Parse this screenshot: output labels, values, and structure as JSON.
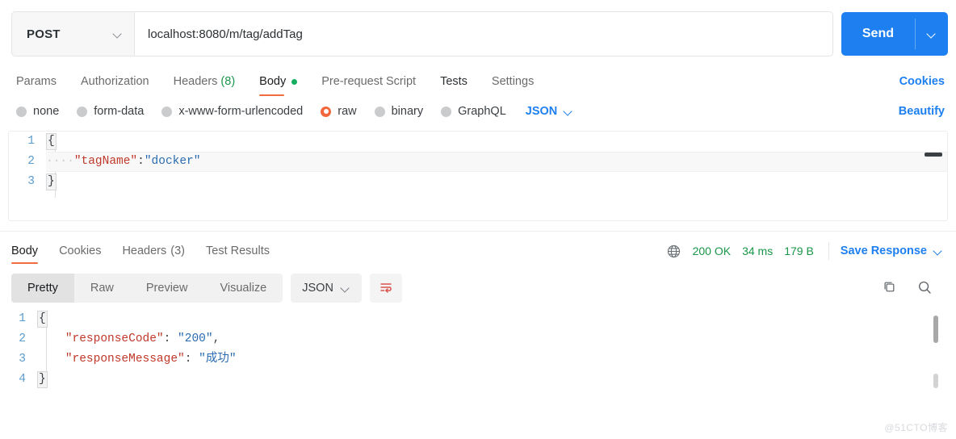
{
  "request": {
    "method": "POST",
    "method_caret_icon": "chevron-down-icon",
    "url": "localhost:8080/m/tag/addTag",
    "url_placeholder": "Enter request URL",
    "send_label": "Send",
    "send_caret_icon": "chevron-down-icon",
    "tabs": [
      {
        "label": "Params",
        "active": false,
        "count": ""
      },
      {
        "label": "Authorization",
        "active": false,
        "count": ""
      },
      {
        "label": "Headers",
        "active": false,
        "count": "(8)"
      },
      {
        "label": "Body",
        "active": true,
        "count": ""
      },
      {
        "label": "Pre-request Script",
        "active": false,
        "count": ""
      },
      {
        "label": "Tests",
        "active": false,
        "count": ""
      },
      {
        "label": "Settings",
        "active": false,
        "count": ""
      }
    ],
    "cookies_label": "Cookies",
    "beautify_label": "Beautify",
    "body_types": [
      {
        "label": "none",
        "selected": false
      },
      {
        "label": "form-data",
        "selected": false
      },
      {
        "label": "x-www-form-urlencoded",
        "selected": false
      },
      {
        "label": "raw",
        "selected": true
      },
      {
        "label": "binary",
        "selected": false
      },
      {
        "label": "GraphQL",
        "selected": false
      }
    ],
    "raw_format": "JSON",
    "raw_format_caret_icon": "chevron-down-icon",
    "body_lines": [
      {
        "num": "1",
        "indent": "",
        "key": "",
        "sep": "",
        "value": "",
        "brace": "{"
      },
      {
        "num": "2",
        "indent": "····",
        "key": "\"tagName\"",
        "sep": ":",
        "value": "\"docker\"",
        "brace": ""
      },
      {
        "num": "3",
        "indent": "",
        "key": "",
        "sep": "",
        "value": "",
        "brace": "}"
      }
    ]
  },
  "response": {
    "tabs": [
      {
        "label": "Body",
        "active": true,
        "count": ""
      },
      {
        "label": "Cookies",
        "active": false,
        "count": ""
      },
      {
        "label": "Headers",
        "active": false,
        "count": "(3)"
      },
      {
        "label": "Test Results",
        "active": false,
        "count": ""
      }
    ],
    "globe_icon": "globe-icon",
    "status": "200 OK",
    "time": "34 ms",
    "size": "179 B",
    "save_label": "Save Response",
    "save_caret_icon": "chevron-down-icon",
    "view_modes": [
      {
        "label": "Pretty",
        "active": true
      },
      {
        "label": "Raw",
        "active": false
      },
      {
        "label": "Preview",
        "active": false
      },
      {
        "label": "Visualize",
        "active": false
      }
    ],
    "format": "JSON",
    "format_caret_icon": "chevron-down-icon",
    "wrap_icon": "word-wrap-icon",
    "copy_icon": "copy-icon",
    "search_icon": "search-icon",
    "body_lines": [
      {
        "num": "1",
        "indent": "",
        "key": "",
        "sep": "",
        "value": "",
        "tail": "",
        "brace": "{"
      },
      {
        "num": "2",
        "indent": "    ",
        "key": "\"responseCode\"",
        "sep": ": ",
        "value": "\"200\"",
        "tail": ",",
        "brace": ""
      },
      {
        "num": "3",
        "indent": "    ",
        "key": "\"responseMessage\"",
        "sep": ": ",
        "value": "\"成功\"",
        "tail": "",
        "brace": ""
      },
      {
        "num": "4",
        "indent": "",
        "key": "",
        "sep": "",
        "value": "",
        "tail": "",
        "brace": "}"
      }
    ]
  },
  "watermark": "@51CTO博客",
  "colors": {
    "accent_blue": "#1d7ff0",
    "underline_orange": "#ef6c3e",
    "status_green": "#1a9648",
    "body_dot_green": "#17ad61",
    "radio_selected": "#f2683c",
    "json_key": "#c0392b",
    "json_string": "#2b6cb0",
    "gutter": "#5c9ccd"
  }
}
